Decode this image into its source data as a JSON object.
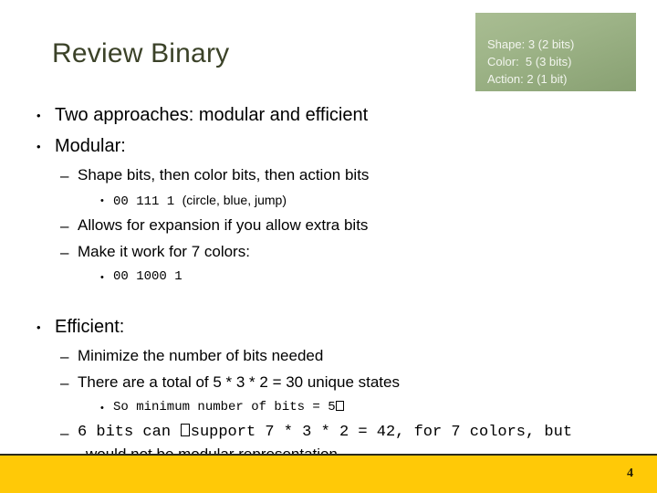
{
  "slide": {
    "title": "Review Binary",
    "number": "4",
    "accent_green_light": "#a9bd92",
    "accent_green_dark": "#88a072",
    "title_color": "#3b4228",
    "footer_color": "#ffc907",
    "footer_rule_color": "#2a2a1c",
    "body_text_color": "#000000"
  },
  "legend": {
    "lines": [
      "Shape: 3 (2 bits)",
      "Color:  5 (3 bits)",
      "Action: 2 (1 bit)"
    ]
  },
  "bullets": [
    {
      "level": 1,
      "marker": "•",
      "text": "Two approaches: modular and efficient"
    },
    {
      "level": 1,
      "marker": "•",
      "text": "Modular:"
    },
    {
      "level": 2,
      "marker": "–",
      "text": "Shape bits, then color bits, then action bits"
    },
    {
      "level": 3,
      "marker": "•",
      "text": "00 111  1  (circle, blue, jump)",
      "mono_prefix": "00 111  1 ",
      "plain_suffix": " (circle, blue, jump)"
    },
    {
      "level": 2,
      "marker": "–",
      "text": "Allows for expansion if you allow extra bits"
    },
    {
      "level": 2,
      "marker": "–",
      "text": "Make it work for 7 colors:"
    },
    {
      "level": 3,
      "marker": "•",
      "text": "00 1000 1",
      "mono_prefix": "00 1000 1",
      "plain_suffix": ""
    },
    {
      "level": 1,
      "marker": "•",
      "text": "Efficient:",
      "gap_before": true
    },
    {
      "level": 2,
      "marker": "–",
      "text": "Minimize the number of bits needed"
    },
    {
      "level": 2,
      "marker": "–",
      "text": "There are a total of 5 * 3 * 2 = 30 unique states"
    },
    {
      "level": 3,
      "marker": "•",
      "text": "So minimum number of bits = 5□",
      "mono_prefix": "So minimum number of bits = 5",
      "has_tofu": true
    },
    {
      "level": 2,
      "marker": "–",
      "text": "6 bits can □support 7 * 3 * 2 = 42, for 7 colors, but",
      "text_continued": "would not be modular representation.",
      "mono_part_a": "6 bits can ",
      "mono_part_b": "support 7 * 3 * 2 = 42, for 7 colors, but",
      "has_tofu": true
    }
  ]
}
